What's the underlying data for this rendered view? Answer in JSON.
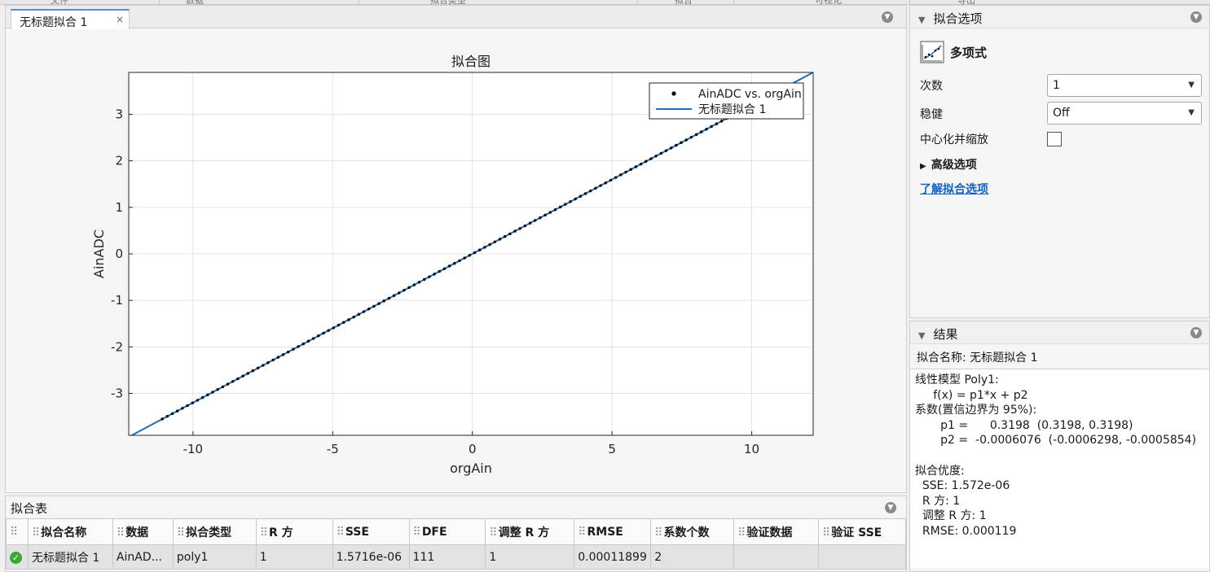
{
  "top_menu": [
    "文件",
    "数据",
    "拟合类型",
    "拟合",
    "可视化",
    "导出"
  ],
  "document": {
    "tab_label": "无标题拟合 1",
    "tab_close": "×"
  },
  "chart_data": {
    "type": "scatter",
    "title": "拟合图",
    "xlabel": "orgAin",
    "ylabel": "AinADC",
    "xlim": [
      -12.3,
      12.2
    ],
    "ylim": [
      -3.9,
      3.9
    ],
    "xticks": [
      -10,
      -5,
      0,
      5,
      10
    ],
    "xtick_labels": [
      "-10",
      "-5",
      "0",
      "5",
      "10"
    ],
    "yticks": [
      -3,
      -2,
      -1,
      0,
      1,
      2,
      3
    ],
    "ytick_labels": [
      "-3",
      "-2",
      "-1",
      "0",
      "1",
      "2",
      "3"
    ],
    "grid": true,
    "legend_position": "top-right",
    "series": [
      {
        "name": "AinADC vs. orgAin",
        "kind": "points",
        "color": "#000000",
        "x_range": [
          -11.1,
          9.1
        ],
        "n_points": 113
      },
      {
        "name": "无标题拟合 1",
        "kind": "line",
        "color": "#1f6fb5",
        "slope": 0.3198,
        "intercept": -0.0006076
      }
    ]
  },
  "fit_table": {
    "title": "拟合表",
    "columns": [
      "",
      "拟合名称",
      "数据",
      "拟合类型",
      "R 方",
      "SSE",
      "DFE",
      "调整 R 方",
      "RMSE",
      "系数个数",
      "验证数据",
      "验证 SSE"
    ],
    "rows": [
      {
        "status_icon": "check-circle-icon",
        "cells": [
          "无标题拟合 1",
          "AinAD...",
          "poly1",
          "1",
          "1.5716e-06",
          "111",
          "1",
          "0.00011899",
          "2",
          "",
          ""
        ]
      }
    ]
  },
  "fit_options": {
    "title": "拟合选项",
    "model_name": "多项式",
    "degree_label": "次数",
    "degree_value": "1",
    "robust_label": "稳健",
    "robust_value": "Off",
    "center_label": "中心化并缩放",
    "center_checked": false,
    "advanced_label": "高级选项",
    "learn_link": "了解拟合选项"
  },
  "results": {
    "title": "结果",
    "fit_name_line": "拟合名称: 无标题拟合 1",
    "body": "线性模型 Poly1:\n     f(x) = p1*x + p2\n系数(置信边界为 95%):\n       p1 =      0.3198  (0.3198, 0.3198)\n       p2 =  -0.0006076  (-0.0006298, -0.0005854)\n\n拟合优度:\n  SSE: 1.572e-06\n  R 方: 1\n  调整 R 方: 1\n  RMSE: 0.000119"
  }
}
